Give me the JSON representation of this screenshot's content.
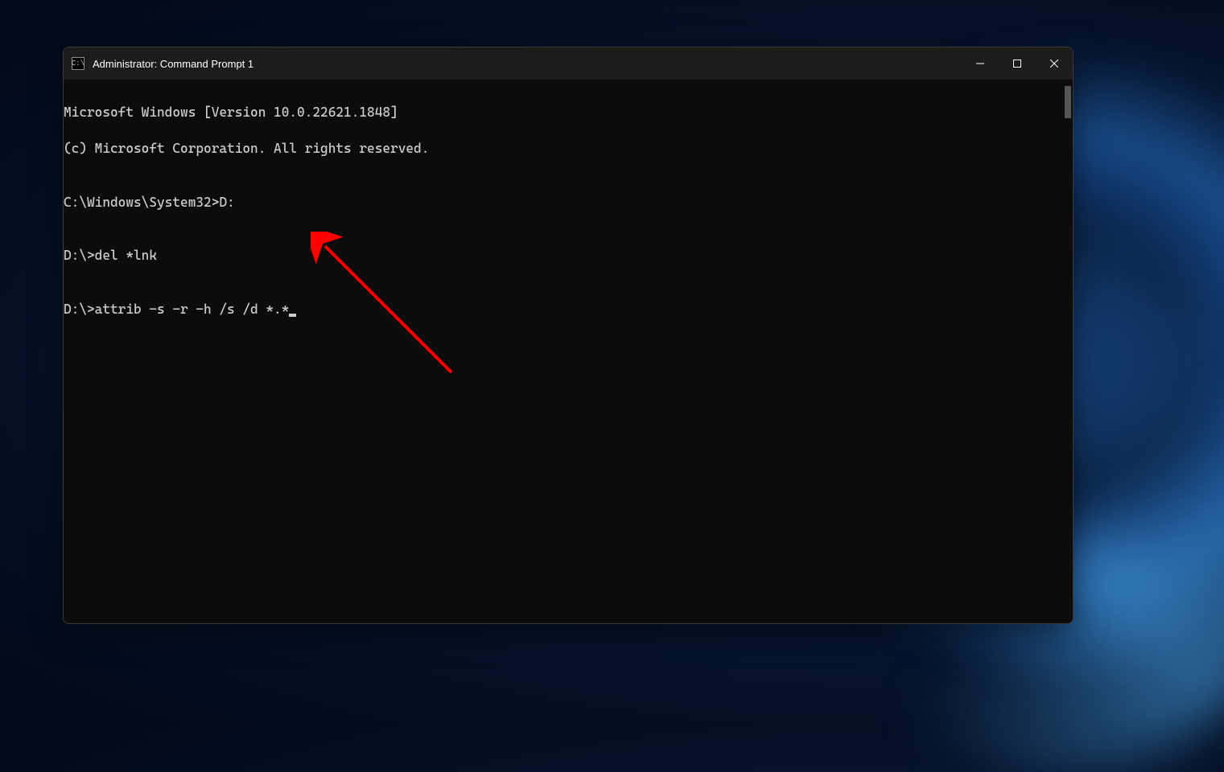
{
  "window": {
    "title": "Administrator: Command Prompt 1",
    "icon_label": "C:\\"
  },
  "terminal": {
    "lines": [
      "Microsoft Windows [Version 10.0.22621.1848]",
      "(c) Microsoft Corporation. All rights reserved.",
      "",
      "C:\\Windows\\System32>D:",
      "",
      "D:\\>del *lnk",
      "",
      "D:\\>attrib -s -r -h /s /d *.*"
    ]
  },
  "controls": {
    "minimize": "minimize",
    "maximize": "maximize",
    "close": "close"
  }
}
